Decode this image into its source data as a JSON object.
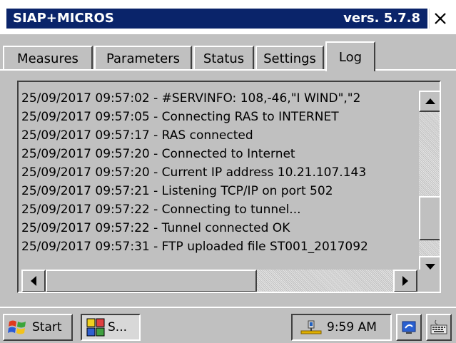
{
  "window": {
    "title": "SIAP+MICROS",
    "version": "vers. 5.7.8",
    "close_label": "✕"
  },
  "tabs": [
    {
      "label": "Measures",
      "active": false
    },
    {
      "label": "Parameters",
      "active": false
    },
    {
      "label": "Status",
      "active": false
    },
    {
      "label": "Settings",
      "active": false
    },
    {
      "label": "Log",
      "active": true
    }
  ],
  "log": {
    "lines": [
      "25/09/2017 09:57:02 - #SERVINFO: 108,-46,\"I WIND\",\"2",
      "25/09/2017 09:57:05 - Connecting RAS to INTERNET",
      "25/09/2017 09:57:17 - RAS connected",
      "25/09/2017 09:57:20 - Connected to Internet",
      "25/09/2017 09:57:20 - Current IP address 10.21.107.143",
      "25/09/2017 09:57:21 - Listening TCP/IP on port 502",
      "25/09/2017 09:57:22 - Connecting to tunnel...",
      "25/09/2017 09:57:22 - Tunnel connected OK",
      "25/09/2017 09:57:31 - FTP uploaded file ST001_2017092"
    ]
  },
  "taskbar": {
    "start_label": "Start",
    "task_label": "S...",
    "clock": "9:59 AM"
  },
  "colors": {
    "title_bar": "#0a246a",
    "face": "#c0c0c0"
  }
}
